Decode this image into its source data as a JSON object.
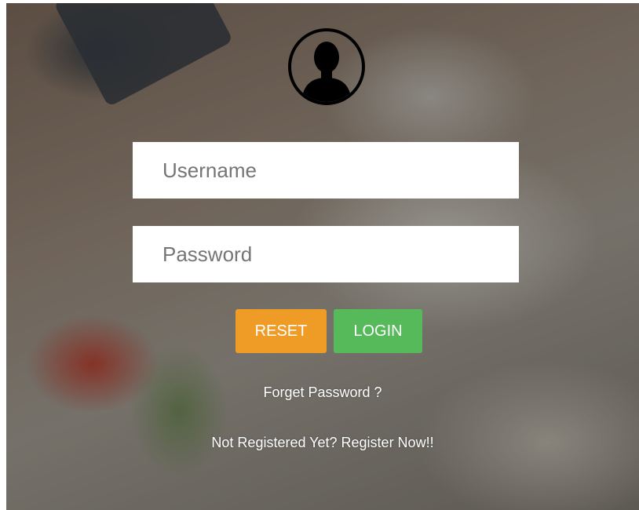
{
  "form": {
    "username_placeholder": "Username",
    "password_placeholder": "Password"
  },
  "buttons": {
    "reset_label": "RESET",
    "login_label": "LOGIN"
  },
  "links": {
    "forgot_password": "Forget Password ?",
    "register": "Not Registered Yet? Register Now!!"
  },
  "icons": {
    "avatar": "user-silhouette-icon"
  },
  "colors": {
    "reset_button": "#ef9c26",
    "login_button": "#56b95a",
    "input_background": "#ffffff",
    "link_text": "#ffffff"
  }
}
